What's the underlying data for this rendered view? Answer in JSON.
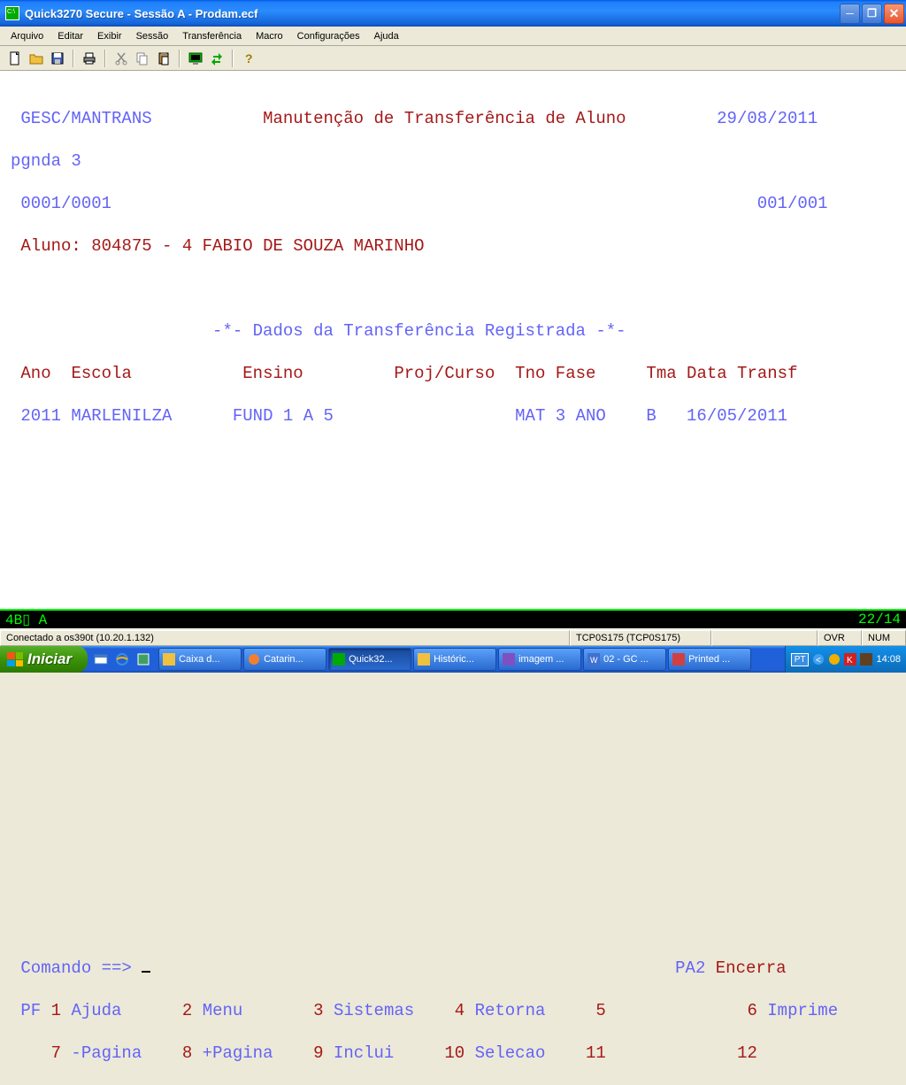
{
  "window": {
    "title": "Quick3270 Secure - Sessão A - Prodam.ecf"
  },
  "menu": [
    "Arquivo",
    "Editar",
    "Exibir",
    "Sessão",
    "Transferência",
    "Macro",
    "Configurações",
    "Ajuda"
  ],
  "screen": {
    "prog": "GESC/MANTRANS",
    "title": "Manutenção de Transferência de Aluno",
    "date": "29/08/2011",
    "pgline": "pgnda 3",
    "counter_left": "0001/0001",
    "counter_right": "001/001",
    "aluno_label": "Aluno:",
    "aluno_value": "804875 - 4 FABIO DE SOUZA MARINHO",
    "section": "-*- Dados da Transferência Registrada -*-",
    "headers": {
      "ano": "Ano",
      "escola": "Escola",
      "ensino": "Ensino",
      "proj": "Proj/Curso",
      "tno": "Tno",
      "fase": "Fase",
      "tma": "Tma",
      "data": "Data Transf"
    },
    "row": {
      "ano": "2011",
      "escola": "MARLENILZA",
      "ensino": "FUND 1 A 5",
      "proj": "",
      "tno": "MAT",
      "fase": "3 ANO",
      "tma": "B",
      "data": "16/05/2011"
    },
    "cmd_label": "Comando ==>",
    "pa2": "PA2",
    "encerra": "Encerra",
    "pf_label": "PF",
    "pf": [
      {
        "n": "1",
        "t": "Ajuda"
      },
      {
        "n": "2",
        "t": "Menu"
      },
      {
        "n": "3",
        "t": "Sistemas"
      },
      {
        "n": "4",
        "t": "Retorna"
      },
      {
        "n": "5",
        "t": ""
      },
      {
        "n": "6",
        "t": "Imprime"
      },
      {
        "n": "7",
        "t": "-Pagina"
      },
      {
        "n": "8",
        "t": "+Pagina"
      },
      {
        "n": "9",
        "t": "Inclui"
      },
      {
        "n": "10",
        "t": "Selecao"
      },
      {
        "n": "11",
        "t": ""
      },
      {
        "n": "12",
        "t": ""
      }
    ]
  },
  "oia": {
    "left": "4B▯   A",
    "right": "22/14"
  },
  "status": {
    "conn": "Conectado a os390t (10.20.1.132)",
    "tcp": "TCP0S175 (TCP0S175)",
    "ovr": "OVR",
    "num": "NUM"
  },
  "taskbar": {
    "start": "Iniciar",
    "buttons": [
      {
        "label": "Caixa d..."
      },
      {
        "label": "Catarin..."
      },
      {
        "label": "Quick32...",
        "active": true
      },
      {
        "label": "Históric..."
      },
      {
        "label": "imagem ..."
      },
      {
        "label": "02 - GC ..."
      },
      {
        "label": "Printed ..."
      }
    ],
    "lang": "PT",
    "clock": "14:08"
  }
}
